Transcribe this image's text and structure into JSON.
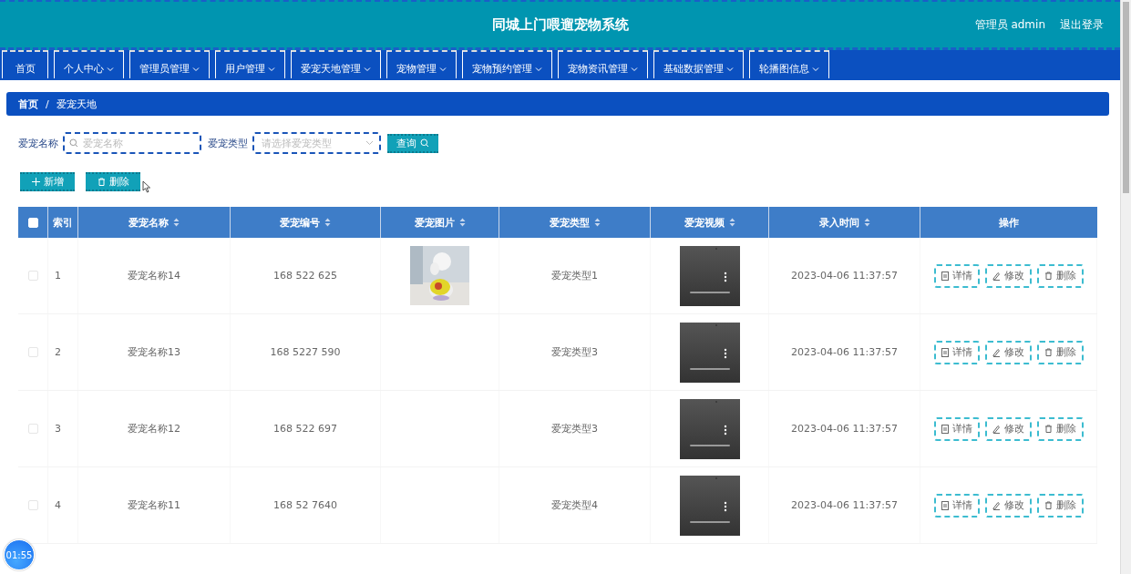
{
  "header": {
    "title": "同城上门喂遛宠物系统",
    "user": "管理员 admin",
    "logout": "退出登录"
  },
  "nav": [
    {
      "label": "首页",
      "dropdown": false
    },
    {
      "label": "个人中心",
      "dropdown": true
    },
    {
      "label": "管理员管理",
      "dropdown": true
    },
    {
      "label": "用户管理",
      "dropdown": true
    },
    {
      "label": "爱宠天地管理",
      "dropdown": true
    },
    {
      "label": "宠物管理",
      "dropdown": true
    },
    {
      "label": "宠物预约管理",
      "dropdown": true
    },
    {
      "label": "宠物资讯管理",
      "dropdown": true
    },
    {
      "label": "基础数据管理",
      "dropdown": true
    },
    {
      "label": "轮播图信息",
      "dropdown": true
    }
  ],
  "breadcrumb": {
    "items": [
      "首页",
      "爱宠天地"
    ],
    "separator": "/"
  },
  "search": {
    "name_label": "爱宠名称",
    "name_placeholder": "爱宠名称",
    "type_label": "爱宠类型",
    "type_placeholder": "请选择爱宠类型",
    "query": "查询"
  },
  "actions": {
    "add": "新增",
    "delete": "删除"
  },
  "table": {
    "columns": [
      {
        "label": "索引",
        "sortable": false
      },
      {
        "label": "爱宠名称",
        "sortable": true
      },
      {
        "label": "爱宠编号",
        "sortable": true
      },
      {
        "label": "爱宠图片",
        "sortable": true
      },
      {
        "label": "爱宠类型",
        "sortable": true
      },
      {
        "label": "爱宠视频",
        "sortable": true
      },
      {
        "label": "录入时间",
        "sortable": true
      },
      {
        "label": "操作",
        "sortable": false
      }
    ],
    "all_checked": false,
    "rows": [
      {
        "checked": false,
        "index": "1",
        "name": "爱宠名称14",
        "code": "168 522 625",
        "has_photo": true,
        "type": "爱宠类型1",
        "time": "2023-04-06 11:37:57",
        "buttons": [
          "详情",
          "修改",
          "删除"
        ]
      },
      {
        "checked": false,
        "index": "2",
        "name": "爱宠名称13",
        "code": "168 5227 590",
        "has_photo": false,
        "type": "爱宠类型3",
        "time": "2023-04-06 11:37:57",
        "buttons": [
          "详情",
          "修改",
          "删除"
        ]
      },
      {
        "checked": false,
        "index": "3",
        "name": "爱宠名称12",
        "code": "168 522 697",
        "has_photo": false,
        "type": "爱宠类型3",
        "time": "2023-04-06 11:37:57",
        "buttons": [
          "详情",
          "修改",
          "删除"
        ]
      },
      {
        "checked": false,
        "index": "4",
        "name": "爱宠名称11",
        "code": "168 52 7640",
        "has_photo": false,
        "type": "爱宠类型4",
        "time": "2023-04-06 11:37:57",
        "buttons": [
          "详情",
          "修改",
          "删除"
        ]
      }
    ]
  },
  "timer": "01:55"
}
